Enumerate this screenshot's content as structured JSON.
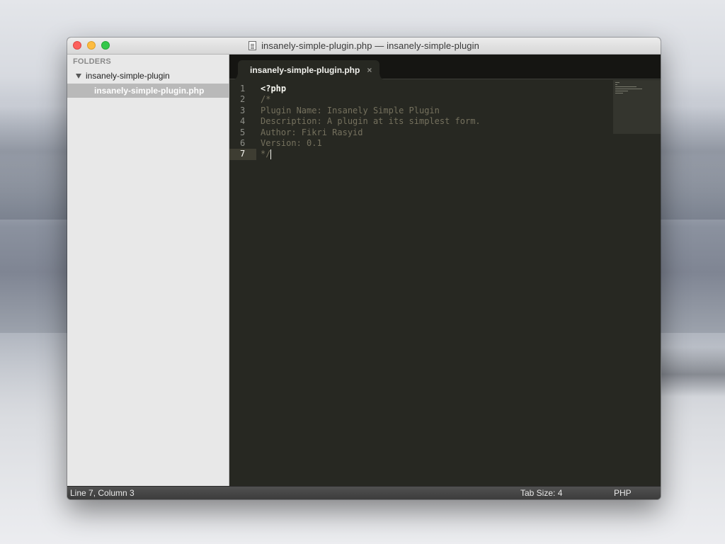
{
  "window": {
    "title": "insanely-simple-plugin.php — insanely-simple-plugin"
  },
  "sidebar": {
    "header": "FOLDERS",
    "folder": "insanely-simple-plugin",
    "file": "insanely-simple-plugin.php"
  },
  "editor": {
    "tab": {
      "label": "insanely-simple-plugin.php",
      "close": "×"
    },
    "line_numbers": [
      "1",
      "2",
      "3",
      "4",
      "5",
      "6",
      "7"
    ],
    "lines": [
      "<?php",
      "/*",
      "Plugin Name: Insanely Simple Plugin",
      "Description: A plugin at its simplest form.",
      "Author: Fikri Rasyid",
      "Version: 0.1",
      "*/"
    ],
    "current_line": 7,
    "colors": {
      "background": "#272822",
      "comment": "#75715e",
      "keyword": "#f8f8f2",
      "gutter": "#8f908a"
    }
  },
  "statusbar": {
    "position": "Line 7, Column 3",
    "tab_size": "Tab Size: 4",
    "syntax": "PHP"
  }
}
